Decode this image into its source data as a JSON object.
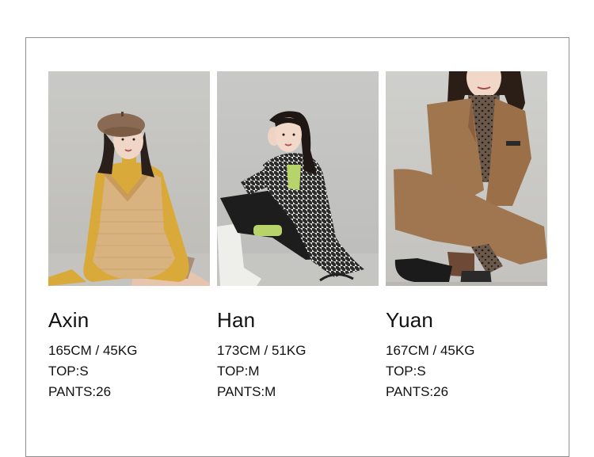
{
  "models": [
    {
      "name": "Axin",
      "measurements": "165CM / 45KG",
      "top": "TOP:S",
      "pants": "PANTS:26",
      "photo_icon": "model-photo-icon"
    },
    {
      "name": "Han",
      "measurements": "173CM / 51KG",
      "top": "TOP:M",
      "pants": "PANTS:M",
      "photo_icon": "model-photo-icon"
    },
    {
      "name": "Yuan",
      "measurements": "167CM / 45KG",
      "top": "TOP:S",
      "pants": "PANTS:26",
      "photo_icon": "model-photo-icon"
    }
  ],
  "colors": {
    "background": "#ffffff",
    "frame_border": "#8f8f8f",
    "text": "#111111"
  }
}
